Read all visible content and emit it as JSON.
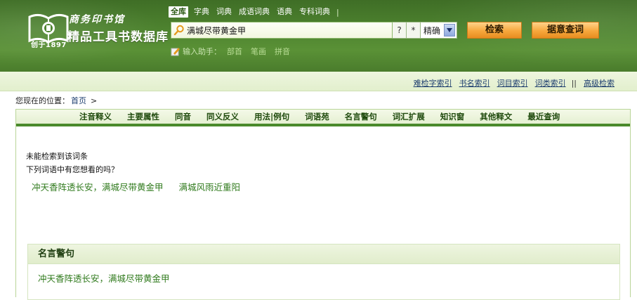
{
  "header": {
    "brand_small": "商务印书馆",
    "brand_big": "精品工具书数据库",
    "logo_since": "创于1897",
    "category_tabs": [
      {
        "label": "全库",
        "active": true
      },
      {
        "label": "字典",
        "active": false
      },
      {
        "label": "词典",
        "active": false
      },
      {
        "label": "成语词典",
        "active": false
      },
      {
        "label": "语典",
        "active": false
      },
      {
        "label": "专科词典",
        "active": false
      }
    ],
    "tab_separator": "|",
    "search": {
      "value": "满城尽带黄金甲",
      "placeholder": "",
      "wildcard_q": "?",
      "wildcard_star": "*",
      "mode": "精确",
      "search_button": "检索",
      "fuzzy_button": "据意查词"
    },
    "input_assist": {
      "label": "输入助手：",
      "links": [
        "部首",
        "笔画",
        "拼音"
      ]
    }
  },
  "index_bar": {
    "links": [
      "难检字索引",
      "书名索引",
      "词目索引",
      "词类索引"
    ],
    "bars": "||",
    "advanced": "高级检索"
  },
  "breadcrumb": {
    "prefix": "您现在的位置：",
    "home": "首页",
    "chevron": ">"
  },
  "feature_tabs": [
    "注音释义",
    "主要属性",
    "同音",
    "同义反义",
    "用法|例句",
    "词语苑",
    "名言警句",
    "词汇扩展",
    "知识窗",
    "其他释文",
    "最近查询"
  ],
  "results": {
    "not_found": "未能检索到该词条",
    "suggest_prompt": "下列词语中有您想看的吗？",
    "suggestions": [
      "冲天香阵透长安，满城尽带黄金甲",
      "满城风雨近重阳"
    ]
  },
  "quote_panel": {
    "title": "名言警句",
    "text": "冲天香阵透长安，满城尽带黄金甲"
  },
  "colors": {
    "header_green": "#4f8530",
    "tab_green": "#1f4a0d",
    "link_green": "#2f7a1c",
    "link_blue": "#1c3d6e",
    "button_orange": "#f7a73c"
  }
}
